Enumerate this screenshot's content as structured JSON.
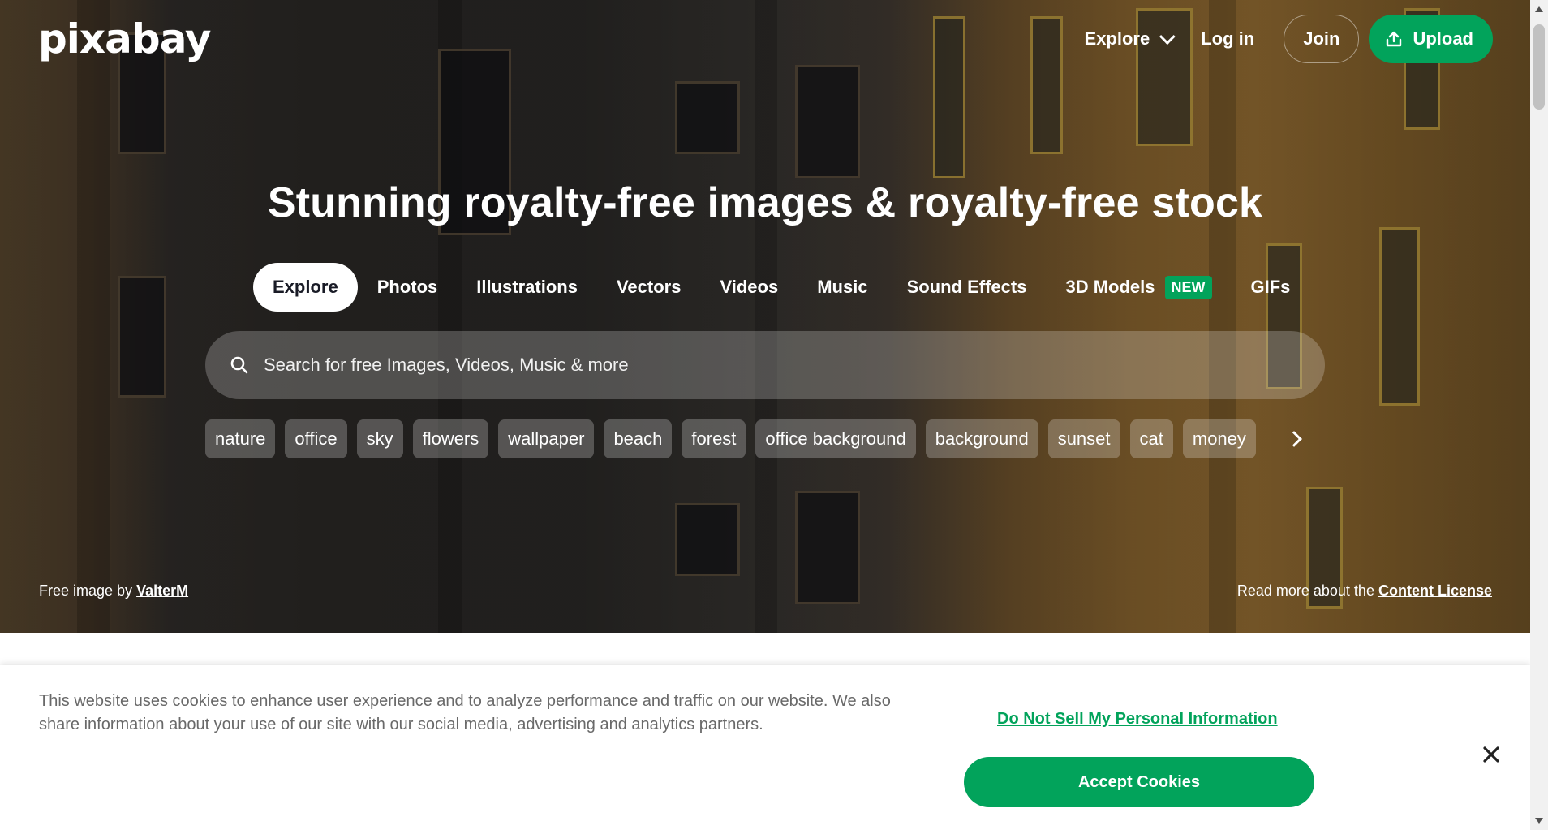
{
  "brand": {
    "logo_text": "pixabay"
  },
  "nav": {
    "explore_label": "Explore",
    "login_label": "Log in",
    "join_label": "Join",
    "upload_label": "Upload"
  },
  "hero": {
    "headline": "Stunning royalty-free images & royalty-free stock",
    "tabs": [
      {
        "label": "Explore",
        "active": true
      },
      {
        "label": "Photos"
      },
      {
        "label": "Illustrations"
      },
      {
        "label": "Vectors"
      },
      {
        "label": "Videos"
      },
      {
        "label": "Music"
      },
      {
        "label": "Sound Effects"
      },
      {
        "label": "3D Models",
        "badge": "NEW"
      },
      {
        "label": "GIFs"
      }
    ],
    "search_placeholder": "Search for free Images, Videos, Music & more",
    "chips": [
      "nature",
      "office",
      "sky",
      "flowers",
      "wallpaper",
      "beach",
      "forest",
      "office background",
      "background",
      "sunset",
      "cat",
      "money"
    ],
    "credit_prefix": "Free image by ",
    "credit_author": "ValterM",
    "license_prefix": "Read more about the ",
    "license_link": "Content License"
  },
  "cookie": {
    "text": "This website uses cookies to enhance user experience and to analyze performance and traffic on our website. We also share information about your use of our site with our social media, advertising and analytics partners.",
    "dns_label": "Do Not Sell My Personal Information",
    "accept_label": "Accept Cookies"
  },
  "colors": {
    "brand_green": "#02a35b"
  },
  "icons": [
    "chevron-down-icon",
    "upload-icon",
    "search-icon",
    "chevron-right-icon",
    "close-icon"
  ]
}
